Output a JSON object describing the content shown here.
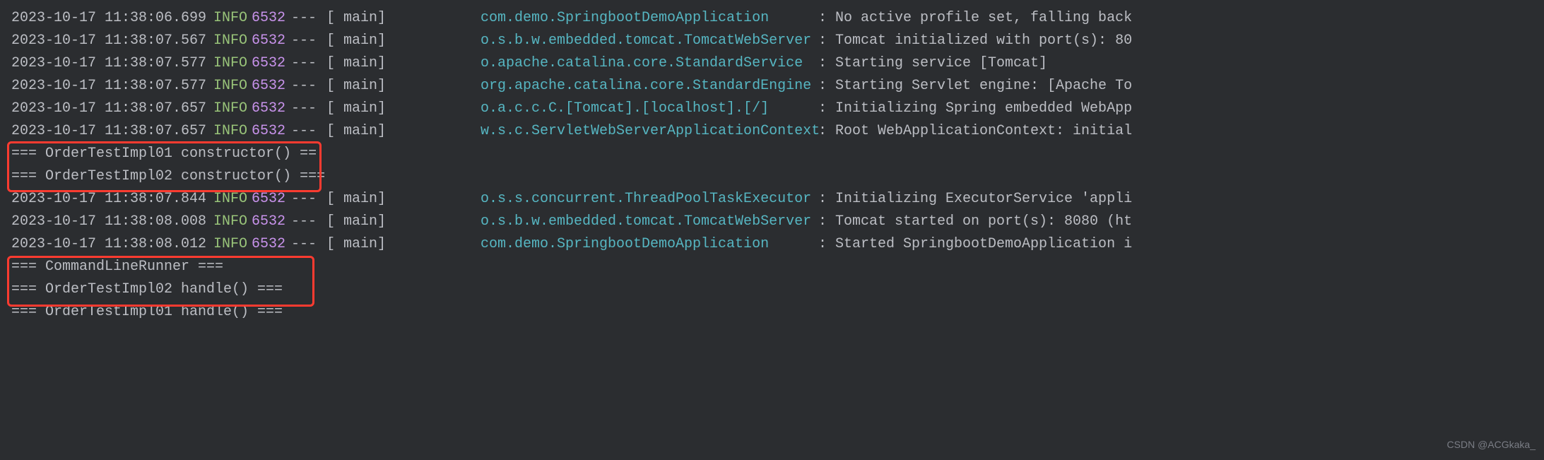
{
  "logs": [
    {
      "ts": "2023-10-17 11:38:06.699",
      "level": "INFO",
      "pid": "6532",
      "dashes": "---",
      "thread": "[           main]",
      "logger": "com.demo.SpringbootDemoApplication",
      "msg": "No active profile set, falling back"
    },
    {
      "ts": "2023-10-17 11:38:07.567",
      "level": "INFO",
      "pid": "6532",
      "dashes": "---",
      "thread": "[           main]",
      "logger": "o.s.b.w.embedded.tomcat.TomcatWebServer",
      "msg": "Tomcat initialized with port(s): 80"
    },
    {
      "ts": "2023-10-17 11:38:07.577",
      "level": "INFO",
      "pid": "6532",
      "dashes": "---",
      "thread": "[           main]",
      "logger": "o.apache.catalina.core.StandardService",
      "msg": "Starting service [Tomcat]"
    },
    {
      "ts": "2023-10-17 11:38:07.577",
      "level": "INFO",
      "pid": "6532",
      "dashes": "---",
      "thread": "[           main]",
      "logger": "org.apache.catalina.core.StandardEngine",
      "msg": "Starting Servlet engine: [Apache To"
    },
    {
      "ts": "2023-10-17 11:38:07.657",
      "level": "INFO",
      "pid": "6532",
      "dashes": "---",
      "thread": "[           main]",
      "logger": "o.a.c.c.C.[Tomcat].[localhost].[/]",
      "msg": "Initializing Spring embedded WebApp"
    },
    {
      "ts": "2023-10-17 11:38:07.657",
      "level": "INFO",
      "pid": "6532",
      "dashes": "---",
      "thread": "[           main]",
      "logger": "w.s.c.ServletWebServerApplicationContext",
      "msg": "Root WebApplicationContext: initial"
    }
  ],
  "plain1": [
    "=== OrderTestImpl01 constructor() ==",
    "=== OrderTestImpl02 constructor() ==="
  ],
  "logs2": [
    {
      "ts": "2023-10-17 11:38:07.844",
      "level": "INFO",
      "pid": "6532",
      "dashes": "---",
      "thread": "[           main]",
      "logger": "o.s.s.concurrent.ThreadPoolTaskExecutor",
      "msg": "Initializing ExecutorService 'appli"
    },
    {
      "ts": "2023-10-17 11:38:08.008",
      "level": "INFO",
      "pid": "6532",
      "dashes": "---",
      "thread": "[           main]",
      "logger": "o.s.b.w.embedded.tomcat.TomcatWebServer",
      "msg": "Tomcat started on port(s): 8080 (ht"
    },
    {
      "ts": "2023-10-17 11:38:08.012",
      "level": "INFO",
      "pid": "6532",
      "dashes": "---",
      "thread": "[           main]",
      "logger": "com.demo.SpringbootDemoApplication",
      "msg": "Started SpringbootDemoApplication i"
    }
  ],
  "plain2": [
    "=== CommandLineRunner ===",
    "=== OrderTestImpl02 handle() ===",
    "=== OrderTestImpl01 handle() ==="
  ],
  "watermark": "CSDN @ACGkaka_",
  "colon": ":"
}
